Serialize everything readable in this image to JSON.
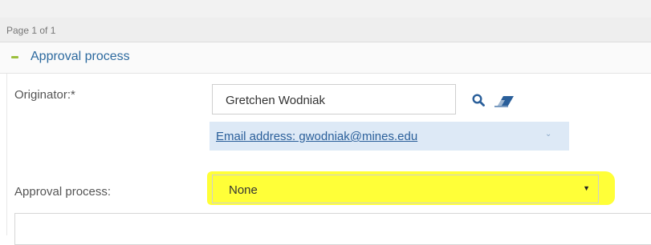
{
  "pager": {
    "text": "Page 1 of 1"
  },
  "section": {
    "title": "Approval process",
    "toggle_icon": "minus-icon"
  },
  "originator": {
    "label": "Originator:*",
    "value": "Gretchen Wodniak",
    "search_icon": "search-icon",
    "clear_icon": "eraser-icon",
    "email_text": "Email address: gwodniak@mines.edu"
  },
  "approval": {
    "label": "Approval process:",
    "selected": "None"
  },
  "colors": {
    "highlight": "#ffff38",
    "link": "#2a5f9a",
    "section_title": "#2d6a9f",
    "email_row_bg": "#dde9f6",
    "collapse_icon": "#9bbf3c"
  }
}
